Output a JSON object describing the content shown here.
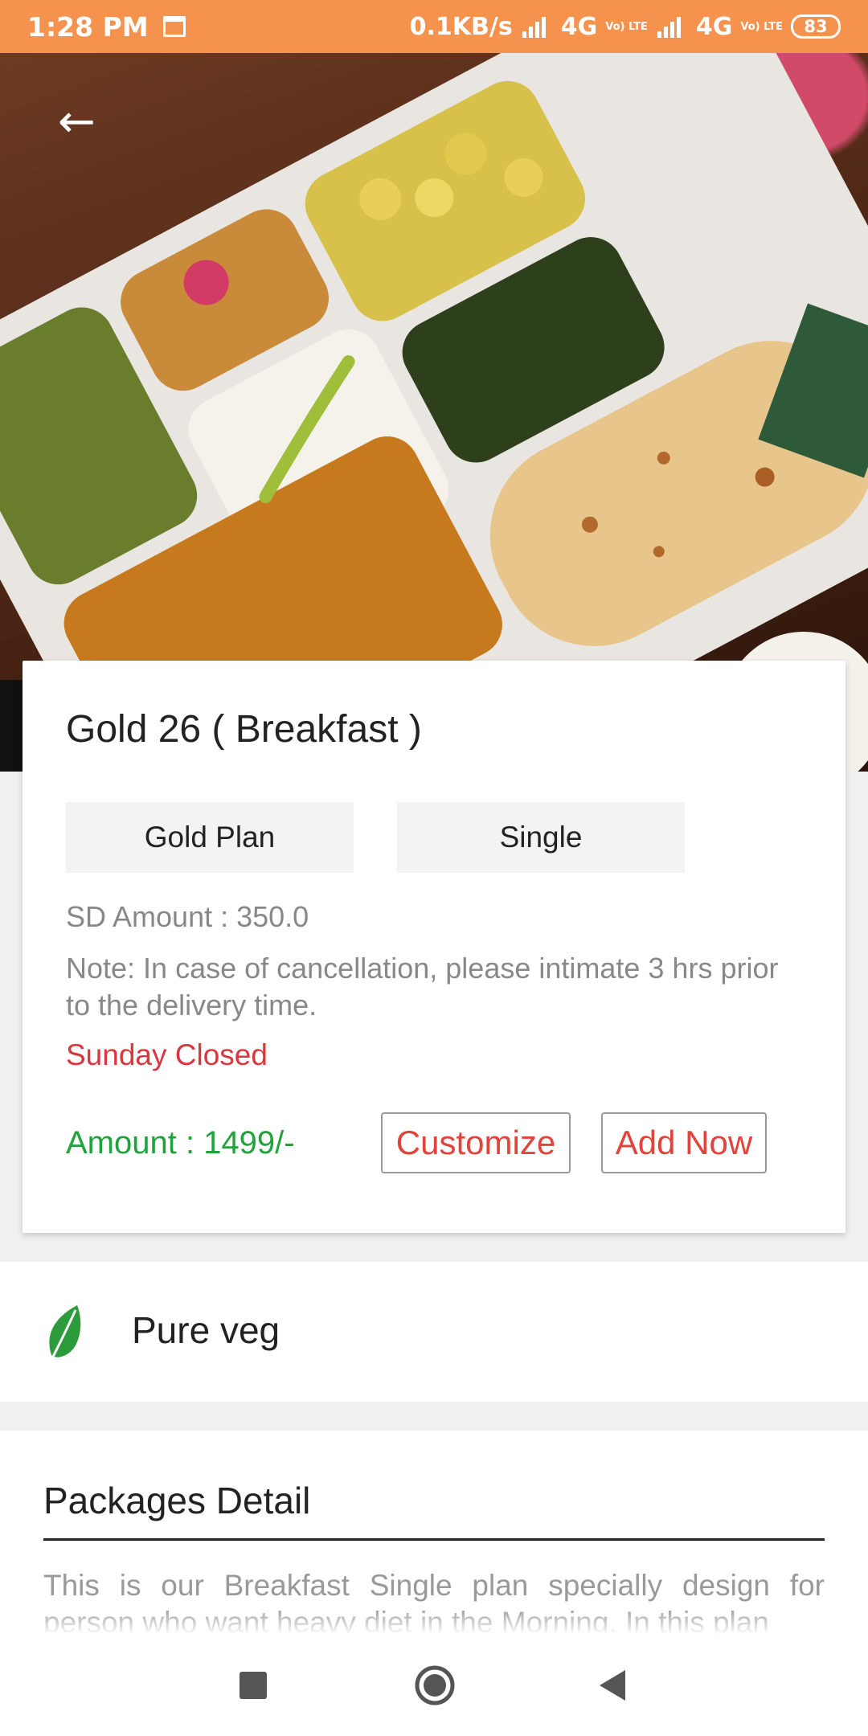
{
  "status_bar": {
    "time": "1:28 PM",
    "network_speed": "0.1KB/s",
    "net1": "4G",
    "net2": "4G",
    "volte": "Vo) LTE",
    "battery": "83"
  },
  "card": {
    "title": "Gold 26 ( Breakfast )",
    "plan_chip": "Gold Plan",
    "type_chip": "Single",
    "sd_amount": "SD Amount : 350.0",
    "note": "Note: In case of cancellation, please intimate 3 hrs prior to the delivery time.",
    "closed": "Sunday Closed",
    "amount": "Amount : 1499/-",
    "customize_label": "Customize",
    "add_now_label": "Add Now"
  },
  "veg": {
    "label": "Pure veg",
    "icon": "leaf-icon"
  },
  "packages": {
    "title": "Packages Detail",
    "description": "This is our Breakfast Single plan specially design for person who want heavy diet in the Morning. In this plan"
  },
  "colors": {
    "status_bar": "#f5934e",
    "amount_green": "#21a33b",
    "accent_red": "#e2433b",
    "closed_red": "#d9363e"
  }
}
